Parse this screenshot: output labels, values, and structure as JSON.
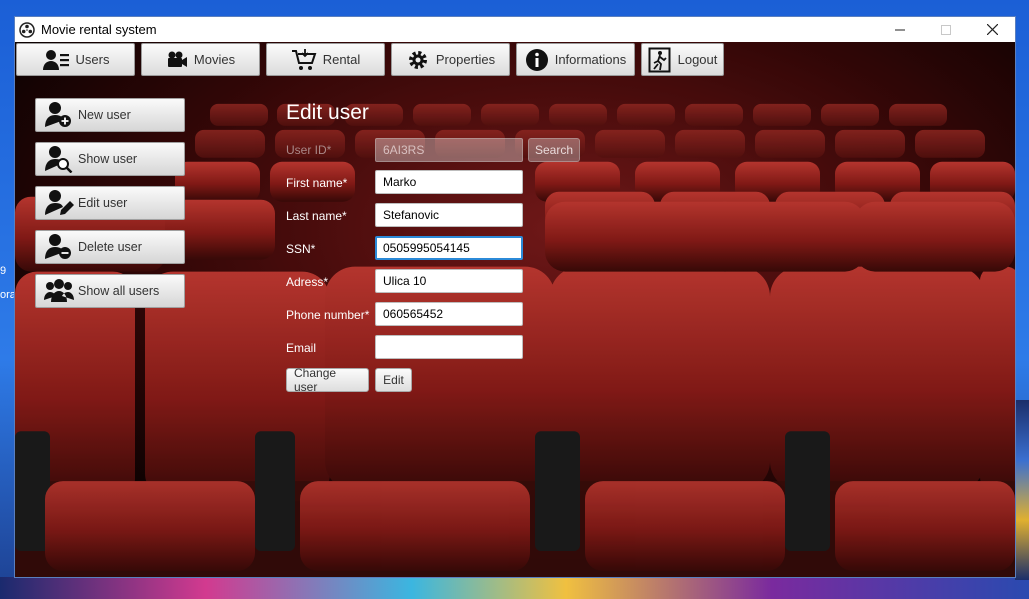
{
  "window": {
    "title": "Movie rental system"
  },
  "menu": [
    {
      "label": "Users",
      "icon": "users-menu-icon"
    },
    {
      "label": "Movies",
      "icon": "camera-icon"
    },
    {
      "label": "Rental",
      "icon": "cart-icon"
    },
    {
      "label": "Properties",
      "icon": "gear-icon"
    },
    {
      "label": "Informations",
      "icon": "info-icon"
    },
    {
      "label": "Logout",
      "icon": "exit-icon"
    }
  ],
  "sidebar": [
    {
      "label": "New user",
      "icon": "add-user-icon"
    },
    {
      "label": "Show user",
      "icon": "search-user-icon"
    },
    {
      "label": "Edit user",
      "icon": "edit-user-icon"
    },
    {
      "label": "Delete user",
      "icon": "remove-user-icon"
    },
    {
      "label": "Show all users",
      "icon": "group-icon"
    }
  ],
  "form": {
    "title": "Edit user",
    "user_id_label": "User ID*",
    "user_id_value": "6AI3RS",
    "search_label": "Search",
    "first_name_label": "First name*",
    "first_name_value": "Marko",
    "last_name_label": "Last name*",
    "last_name_value": "Stefanovic",
    "ssn_label": "SSN*",
    "ssn_value": "0505995054145",
    "adress_label": "Adress*",
    "adress_value": "Ulica 10",
    "phone_label": "Phone number*",
    "phone_value": "060565452",
    "email_label": "Email",
    "email_value": "",
    "change_user_label": "Change user",
    "edit_label": "Edit"
  },
  "desktop": {
    "edge_text": "ora"
  }
}
